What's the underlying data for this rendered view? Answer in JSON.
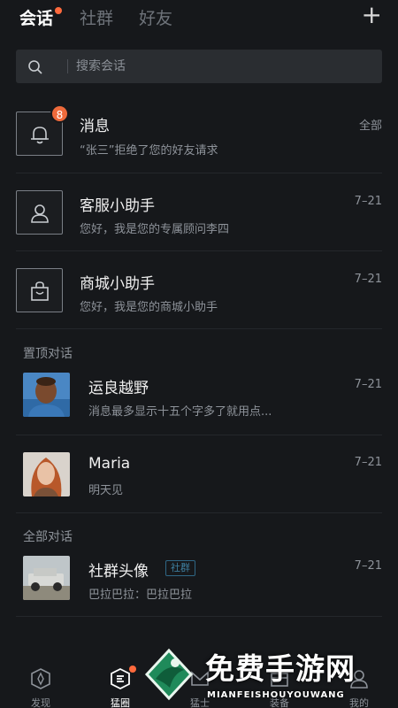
{
  "tabs": [
    {
      "label": "会话",
      "active": true
    },
    {
      "label": "社群",
      "active": false
    },
    {
      "label": "好友",
      "active": false
    }
  ],
  "add_icon": "plus-icon",
  "search": {
    "placeholder": "搜索会话",
    "value": ""
  },
  "system_chats": [
    {
      "title": "消息",
      "subtitle": "“张三”拒绝了您的好友请求",
      "meta": "全部",
      "badge": "8",
      "icon": "bell-icon"
    },
    {
      "title": "客服小助手",
      "subtitle": "您好，我是您的专属顾问李四",
      "meta": "7–21",
      "icon": "customer-service-icon"
    },
    {
      "title": "商城小助手",
      "subtitle": "您好，我是您的商城小助手",
      "meta": "7–21",
      "icon": "shopping-bag-icon"
    }
  ],
  "pinned": {
    "header": "置顶对话",
    "items": [
      {
        "title": "运良越野",
        "subtitle": "消息最多显示十五个字多了就用点...",
        "time": "7–21"
      },
      {
        "title": "Maria",
        "subtitle": "明天见",
        "time": "7–21"
      }
    ]
  },
  "all": {
    "header": "全部对话",
    "items": [
      {
        "title": "社群头像",
        "tag": "社群",
        "subtitle": "巴拉巴拉：巴拉巴拉",
        "time": "7–21"
      }
    ]
  },
  "bottom_nav": [
    {
      "label": "发现",
      "icon": "compass-icon",
      "active": false
    },
    {
      "label": "猛圈",
      "icon": "circle-feed-icon",
      "active": true
    },
    {
      "label": "猛士",
      "icon": "warrior-icon",
      "active": false
    },
    {
      "label": "装备",
      "icon": "equipment-icon",
      "active": false
    },
    {
      "label": "我的",
      "icon": "profile-icon",
      "active": false
    }
  ],
  "watermark": {
    "text": "免费手游网",
    "sub": "MIANFEISHOUYOUWANG"
  },
  "colors": {
    "accent": "#ee6a3b",
    "background": "#16181b",
    "tag": "#2f6785"
  }
}
